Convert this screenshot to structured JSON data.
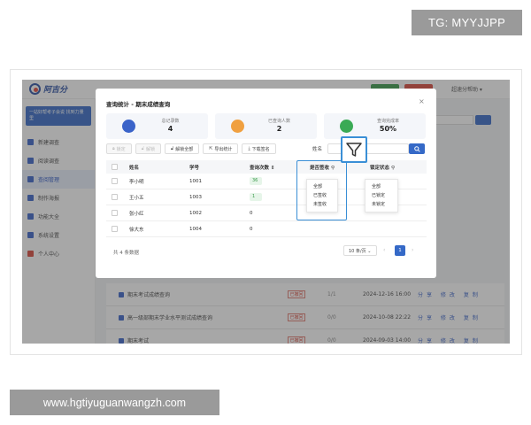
{
  "watermarks": {
    "top": "TG: MYYJJPP",
    "bottom": "www.hgtiyuguanwangzh.com"
  },
  "app": {
    "logo": "阿吉分",
    "user": "超速分帮助 ▾",
    "sidebar_banner": "一站好帮考子会说 找到力量里",
    "sidebar": [
      "新建调查",
      "阅读调查",
      "查阅管理",
      "制作海报",
      "功能大全",
      "系统设置",
      "个人中心"
    ],
    "bg_rows": [
      {
        "title": "期末考试成绩查询",
        "tag": "已撤回",
        "count": "1/1",
        "date": "2024-12-16 16:00",
        "ops": "分享 修改 复制"
      },
      {
        "title": "高一级部期末学业水平测试成绩查询",
        "tag": "已撤回",
        "count": "0/0",
        "date": "2024-10-08 22:22",
        "ops": "分享 修改 复制"
      },
      {
        "title": "期末考试",
        "tag": "已撤回",
        "count": "0/0",
        "date": "2024-09-03 14:00",
        "ops": "分享 修改 复制"
      }
    ]
  },
  "modal": {
    "title": "查询统计 - 期末成绩查询",
    "close": "×",
    "stats": [
      {
        "label": "总记录数",
        "value": "4",
        "color": "#3a63c9"
      },
      {
        "label": "已查询人数",
        "value": "2",
        "color": "#f0a040"
      },
      {
        "label": "查询完成率",
        "value": "50%",
        "color": "#3aaa55"
      }
    ],
    "toolbar": {
      "lock": "锁定",
      "unlock": "解锁",
      "unlock_all": "解锁全部",
      "export": "导出统计",
      "download": "下载签名"
    },
    "search": {
      "label": "姓名",
      "placeholder": ""
    },
    "columns": {
      "name": "姓名",
      "id": "学号",
      "count": "查询次数 ⇕",
      "signed": "是否签收",
      "locked": "锁定状态"
    },
    "rows": [
      {
        "name": "李小明",
        "id": "1001",
        "count": "36"
      },
      {
        "name": "王小五",
        "id": "1003",
        "count": "1"
      },
      {
        "name": "张小红",
        "id": "1002",
        "count": "0"
      },
      {
        "name": "徐大东",
        "id": "1004",
        "count": "0"
      }
    ],
    "signed_filter": [
      "全部",
      "已签收",
      "未签收"
    ],
    "locked_filter": [
      "全部",
      "已锁定",
      "未锁定"
    ],
    "footer": {
      "total": "共 4 条数据",
      "page_size": "10 条/页 ⌄",
      "page": "1",
      "prev": "‹",
      "next": "›"
    }
  }
}
